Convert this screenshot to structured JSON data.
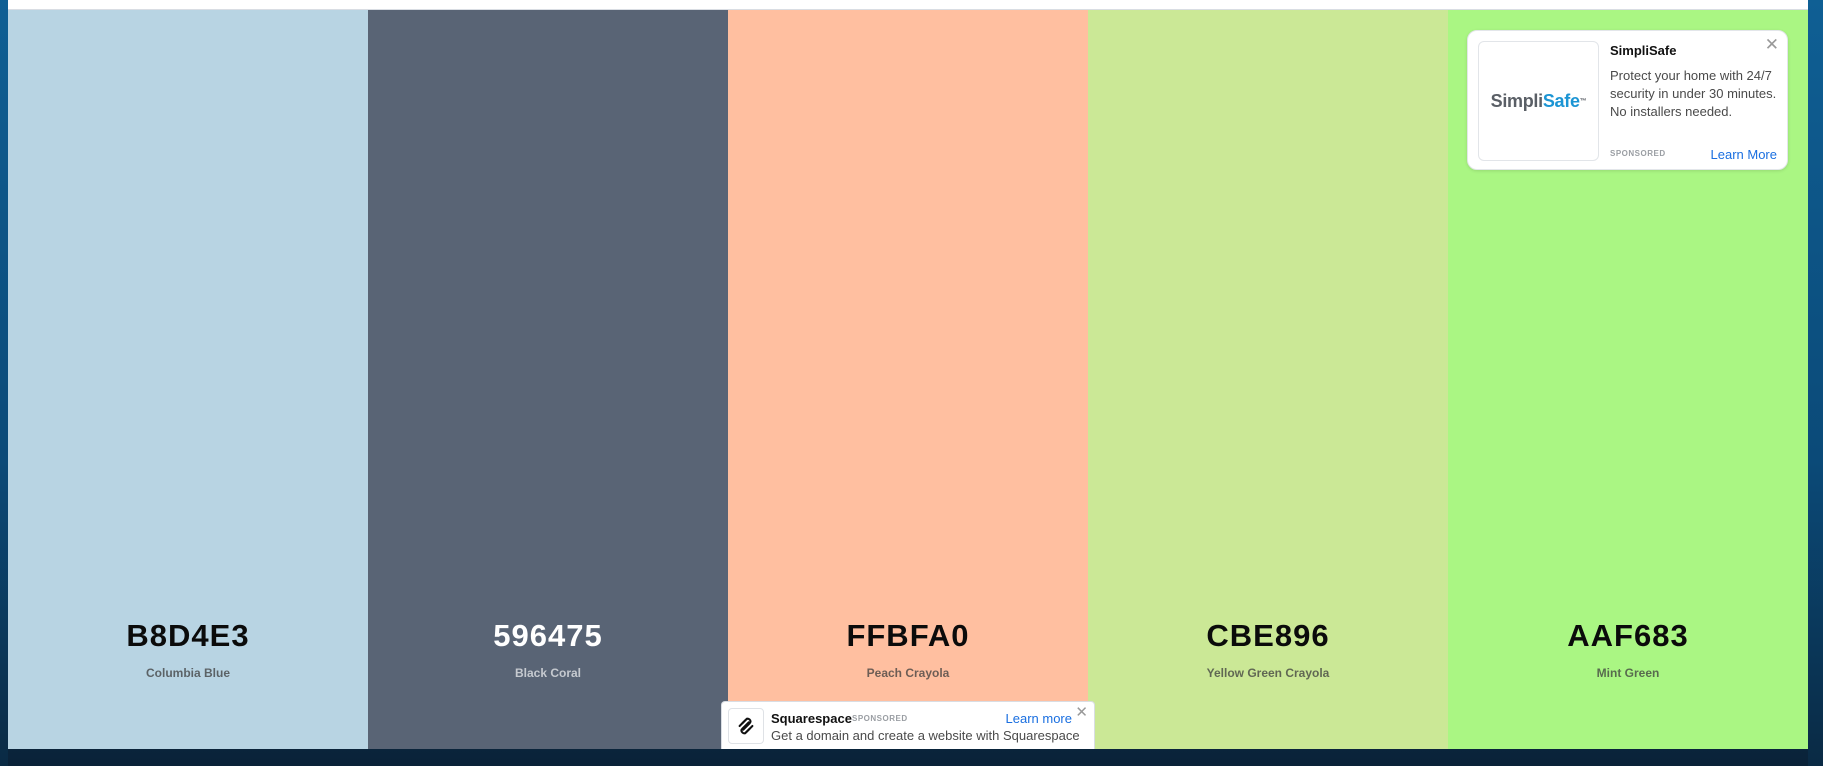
{
  "palette": {
    "colors": [
      {
        "hex": "B8D4E3",
        "name": "Columbia Blue",
        "bg": "#B8D4E3",
        "tone": "light"
      },
      {
        "hex": "596475",
        "name": "Black Coral",
        "bg": "#596475",
        "tone": "dark"
      },
      {
        "hex": "FFBFA0",
        "name": "Peach Crayola",
        "bg": "#FFBFA0",
        "tone": "light"
      },
      {
        "hex": "CBE896",
        "name": "Yellow Green Crayola",
        "bg": "#CBE896",
        "tone": "light"
      },
      {
        "hex": "AAF683",
        "name": "Mint Green",
        "bg": "#AAF683",
        "tone": "light"
      }
    ]
  },
  "side_ad": {
    "logo_part1": "Simpli",
    "logo_part2": "Safe",
    "logo_mark": "™",
    "title": "SimpliSafe",
    "body": "Protect your home with 24/7 security in under 30 minutes. No installers needed.",
    "sponsored": "SPONSORED",
    "cta": "Learn More",
    "close_icon": "close-icon"
  },
  "bottom_ad": {
    "brand": "Squarespace",
    "sponsored": "SPONSORED",
    "description": "Get a domain and create a website with Squarespace",
    "cta": "Learn more",
    "logo_icon": "squarespace-logo-icon",
    "close_icon": "close-icon"
  }
}
